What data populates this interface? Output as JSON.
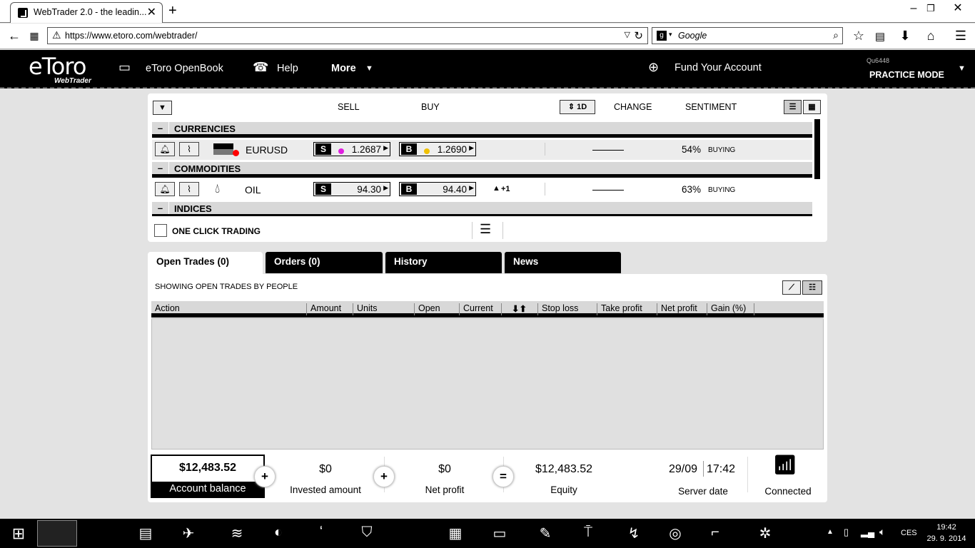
{
  "browser": {
    "tab_title": "WebTrader 2.0 - the leadin...",
    "url": "https://www.etoro.com/webtrader/",
    "search_placeholder": "Google"
  },
  "header": {
    "logo": "eToro",
    "logo_sub": "WebTrader",
    "openbook": "eToro OpenBook",
    "help": "Help",
    "more": "More",
    "fund": "Fund Your Account",
    "user_name": "Qu6448",
    "mode": "PRACTICE MODE"
  },
  "market": {
    "filter_label": "▼",
    "col_sell": "SELL",
    "col_buy": "BUY",
    "period": "1D",
    "col_change": "CHANGE",
    "col_sentiment": "SENTIMENT",
    "categories": [
      {
        "name": "CURRENCIES"
      },
      {
        "name": "COMMODITIES"
      },
      {
        "name": "INDICES"
      }
    ],
    "instruments": [
      {
        "symbol": "EURUSD",
        "sell_label": "S",
        "sell": "1.2687",
        "buy_label": "B",
        "buy": "1.2690",
        "change": "",
        "sentiment_pct": "54%",
        "sentiment": "BUYING",
        "sell_dot_color": "#e020e0",
        "buy_dot_color": "#f0c000"
      },
      {
        "symbol": "OIL",
        "sell_label": "S",
        "sell": "94.30",
        "buy_label": "B",
        "buy": "94.40",
        "change": "+1",
        "sentiment_pct": "63%",
        "sentiment": "BUYING"
      }
    ],
    "one_click": "ONE CLICK TRADING"
  },
  "tabs": [
    {
      "label": "Open Trades (0)",
      "active": true
    },
    {
      "label": "Orders (0)",
      "active": false
    },
    {
      "label": "History",
      "active": false
    },
    {
      "label": "News",
      "active": false
    }
  ],
  "trades": {
    "subtitle": "SHOWING OPEN TRADES BY PEOPLE",
    "columns": [
      "Action",
      "Amount",
      "Units",
      "Open",
      "Current",
      "",
      "Stop loss",
      "Take profit",
      "Net profit",
      "Gain (%)"
    ]
  },
  "summary": {
    "balance": "$12,483.52",
    "balance_label": "Account balance",
    "invested": "$0",
    "invested_label": "Invested amount",
    "net_profit": "$0",
    "net_profit_label": "Net profit",
    "equity": "$12,483.52",
    "equity_label": "Equity",
    "server_date": "29/09",
    "server_time": "17:42",
    "server_label": "Server date",
    "connection": "Connected"
  },
  "taskbar": {
    "lang": "CES",
    "time": "19:42",
    "date": "29. 9. 2014"
  }
}
